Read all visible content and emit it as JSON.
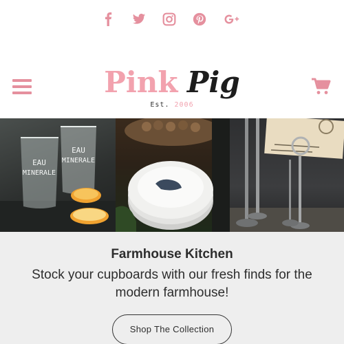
{
  "colors": {
    "accent": "#e5909e",
    "logo_pink": "#f2a2ae",
    "promo_bg": "#eeeeee",
    "text": "#2d2d2d"
  },
  "social": [
    {
      "icon": "facebook-icon"
    },
    {
      "icon": "twitter-icon"
    },
    {
      "icon": "instagram-icon"
    },
    {
      "icon": "pinterest-icon"
    },
    {
      "icon": "google-plus-icon"
    }
  ],
  "header": {
    "menu_icon": "hamburger-menu-icon",
    "cart_icon": "shopping-cart-icon",
    "logo": {
      "word1": "Pink",
      "word2": "Pig",
      "est_label": "Est.",
      "est_year": "2006"
    }
  },
  "hero": {
    "panels": [
      {
        "label": "EAU\nMINÉRALE"
      },
      {
        "label": ""
      },
      {
        "label": ""
      }
    ],
    "glass_text_1": "EAU",
    "glass_text_2": "MINERALE"
  },
  "promo": {
    "title": "Farmhouse Kitchen",
    "text": "Stock your cupboards with our fresh finds for the modern farmhouse!",
    "button": "Shop The Collection"
  }
}
